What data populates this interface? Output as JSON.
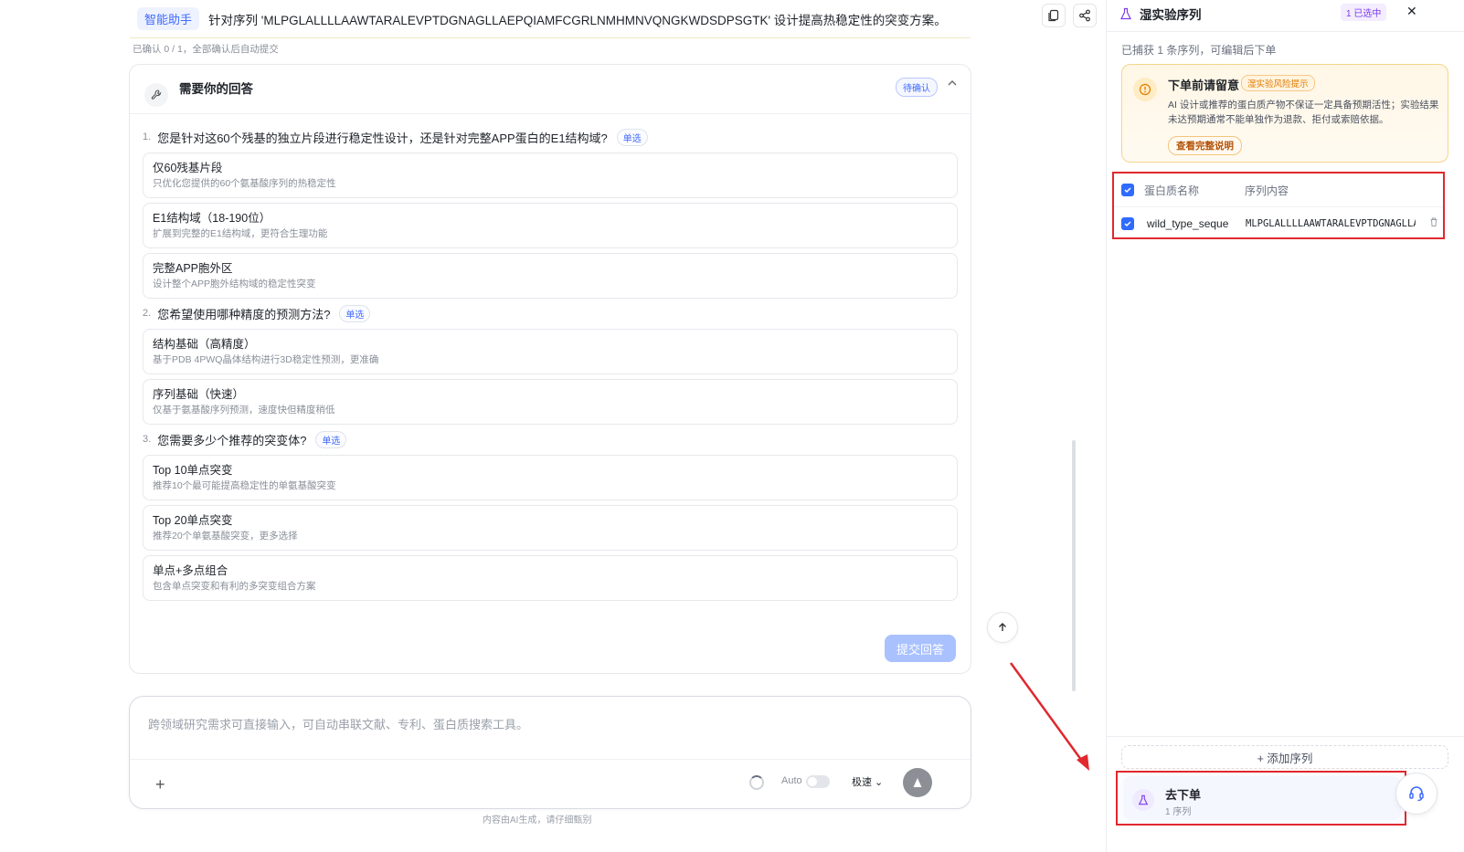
{
  "header": {
    "assistant_tag": "智能助手",
    "message": "针对序列 'MLPGLALLLLAAWTARALEVPTDGNAGLLAEPQIAMFCGRLNMHMNVQNGKWDSDPSGTK' 设计提高热稳定性的突变方案。",
    "confirm_note": "已确认 0 / 1，全部确认后自动提交"
  },
  "question_card": {
    "title": "需要你的回答",
    "status": "待确认",
    "single_label": "单选",
    "questions": [
      {
        "num": "1.",
        "text": "您是针对这60个残基的独立片段进行稳定性设计，还是针对完整APP蛋白的E1结构域?",
        "options": [
          {
            "title": "仅60残基片段",
            "desc": "只优化您提供的60个氨基酸序列的热稳定性"
          },
          {
            "title": "E1结构域（18-190位）",
            "desc": "扩展到完整的E1结构域，更符合生理功能"
          },
          {
            "title": "完整APP胞外区",
            "desc": "设计整个APP胞外结构域的稳定性突变"
          }
        ]
      },
      {
        "num": "2.",
        "text": "您希望使用哪种精度的预测方法?",
        "options": [
          {
            "title": "结构基础（高精度）",
            "desc": "基于PDB 4PWQ晶体结构进行3D稳定性预测，更准确"
          },
          {
            "title": "序列基础（快速）",
            "desc": "仅基于氨基酸序列预测，速度快但精度稍低"
          }
        ]
      },
      {
        "num": "3.",
        "text": "您需要多少个推荐的突变体?",
        "options": [
          {
            "title": "Top 10单点突变",
            "desc": "推荐10个最可能提高稳定性的单氨基酸突变"
          },
          {
            "title": "Top 20单点突变",
            "desc": "推荐20个单氨基酸突变，更多选择"
          },
          {
            "title": "单点+多点组合",
            "desc": "包含单点突变和有利的多突变组合方案"
          }
        ]
      }
    ],
    "submit_label": "提交回答"
  },
  "input": {
    "placeholder": "跨领域研究需求可直接输入，可自动串联文献、专利、蛋白质搜索工具。",
    "plus": "+",
    "auto_label": "Auto",
    "speed_label": "极速 ⌄",
    "ai_note": "内容由AI生成，请仔细甄别"
  },
  "right_panel": {
    "title": "湿实验序列",
    "selected_badge": "1 已选中",
    "captured": "已捕获 1 条序列，可编辑后下单",
    "warning": {
      "title": "下单前请留意",
      "tag": "湿实验风险提示",
      "text": "AI 设计或推荐的蛋白质产物不保证一定具备预期活性；实验结果未达预期通常不能单独作为退款、拒付或索赔依据。",
      "link": "查看完整说明"
    },
    "table": {
      "col_name": "蛋白质名称",
      "col_seq": "序列内容",
      "rows": [
        {
          "name": "wild_type_seque",
          "seq": "MLPGLALLLLAAWTARALEVPTDGNAGLLAEPQIAMFCGRLNMHMNVQNGKWDSDPSGTK"
        }
      ]
    },
    "add_seq": "+ 添加序列",
    "order": {
      "title": "去下单",
      "sub": "1 序列"
    }
  },
  "colors": {
    "accent": "#3f6bff",
    "highlight_box": "#e0282e",
    "submit_disabled": "#a9c1ff"
  }
}
